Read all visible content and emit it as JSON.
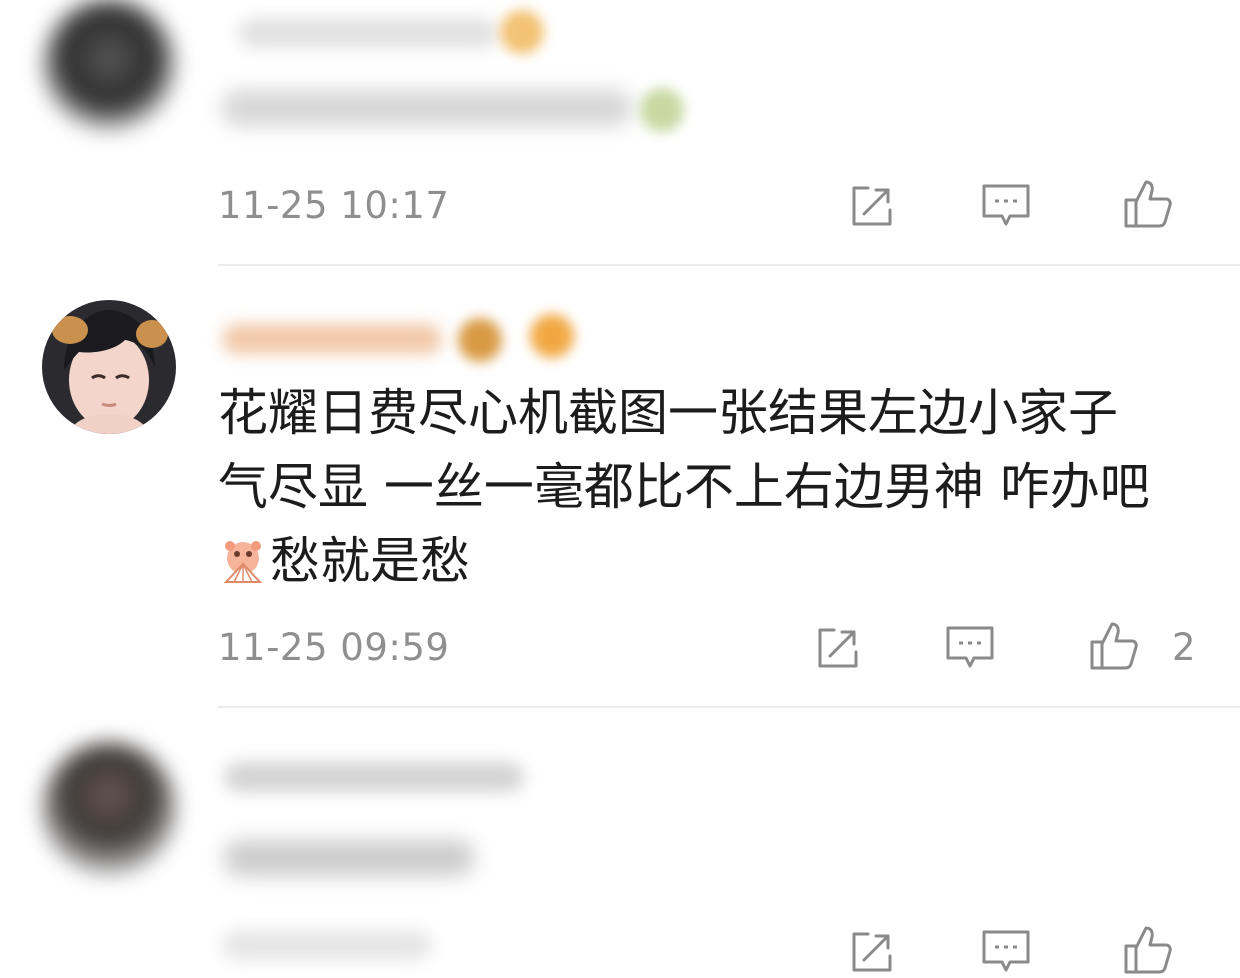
{
  "comments": [
    {
      "username": "",
      "text": "",
      "timestamp": "11-25 10:17",
      "likes": "",
      "blurred": true
    },
    {
      "username": "",
      "text_lines": [
        "花耀日费尽心机截图一张结果左边小家子",
        "气尽显 一丝一毫都比不上右边男神 咋办吧",
        "愁就是愁"
      ],
      "emoji": "fan-cover-emoji",
      "timestamp": "11-25 09:59",
      "likes": "2",
      "blurred": false
    },
    {
      "username": "",
      "text": "",
      "timestamp": "",
      "likes": "",
      "blurred": true
    }
  ],
  "icons": {
    "share": "share-icon",
    "reply": "reply-comment-icon",
    "like": "thumbs-up-icon"
  },
  "colors": {
    "timestamp": "#8f8f8f",
    "text": "#1c1c1c",
    "divider": "#ececec",
    "badge": "#f0b04a"
  }
}
